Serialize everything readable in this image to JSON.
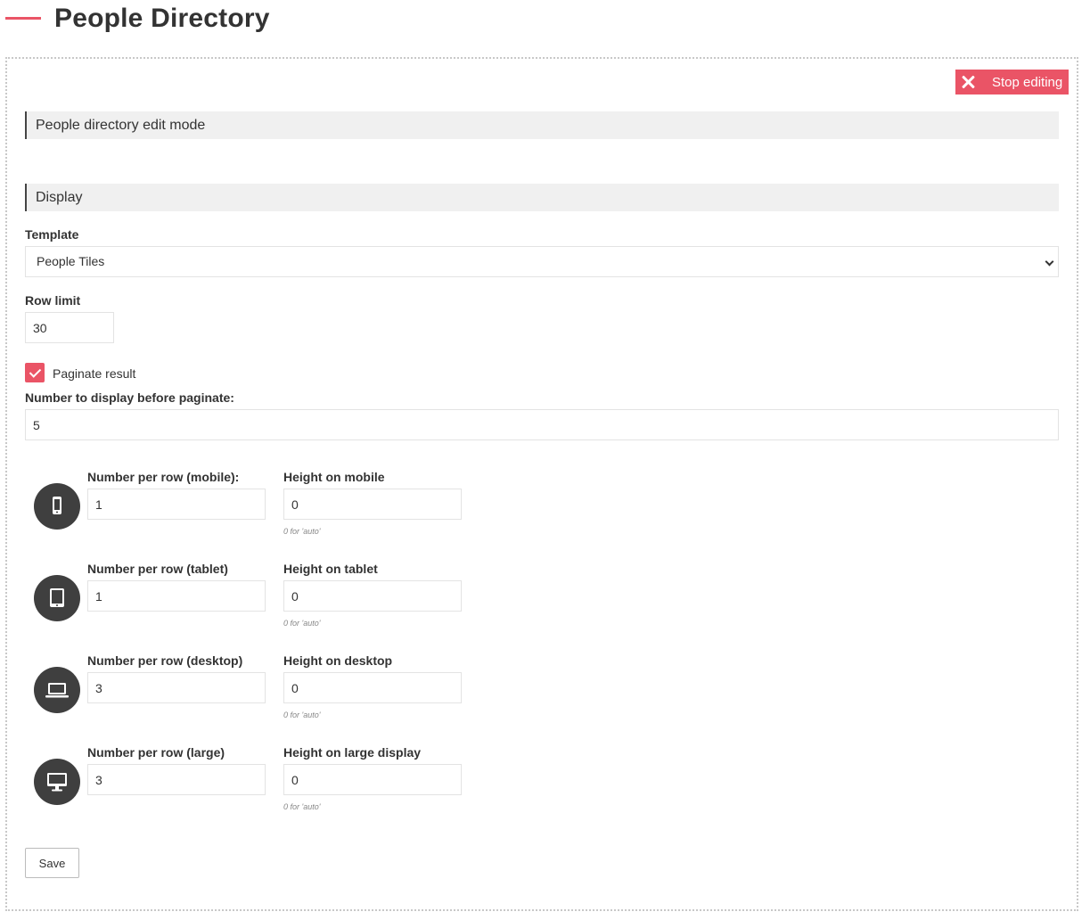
{
  "header": {
    "title": "People Directory"
  },
  "toolbar": {
    "stop_editing_label": "Stop editing",
    "stop_icon": "close-icon"
  },
  "sections": {
    "edit_mode": "People directory edit mode",
    "display": "Display"
  },
  "template": {
    "label": "Template",
    "selected": "People Tiles"
  },
  "row_limit": {
    "label": "Row limit",
    "value": "30"
  },
  "paginate": {
    "label": "Paginate result",
    "checked": true
  },
  "paginate_count": {
    "label": "Number to display before paginate:",
    "value": "5"
  },
  "devices": [
    {
      "icon": "mobile-phone-icon",
      "per_row_label": "Number per row (mobile):",
      "per_row_value": "1",
      "height_label": "Height on mobile",
      "height_value": "0",
      "hint": "0 for 'auto'"
    },
    {
      "icon": "tablet-icon",
      "per_row_label": "Number per row (tablet)",
      "per_row_value": "1",
      "height_label": "Height on tablet",
      "height_value": "0",
      "hint": "0 for 'auto'"
    },
    {
      "icon": "laptop-icon",
      "per_row_label": "Number per row (desktop)",
      "per_row_value": "3",
      "height_label": "Height on desktop",
      "height_value": "0",
      "hint": "0 for 'auto'"
    },
    {
      "icon": "desktop-monitor-icon",
      "per_row_label": "Number per row (large)",
      "per_row_value": "3",
      "height_label": "Height on large display",
      "height_value": "0",
      "hint": "0 for 'auto'"
    }
  ],
  "save": {
    "label": "Save"
  },
  "colors": {
    "accent": "#ea5466",
    "icon_circle": "#3f3f3f",
    "section_bg": "#f0f0f0"
  }
}
